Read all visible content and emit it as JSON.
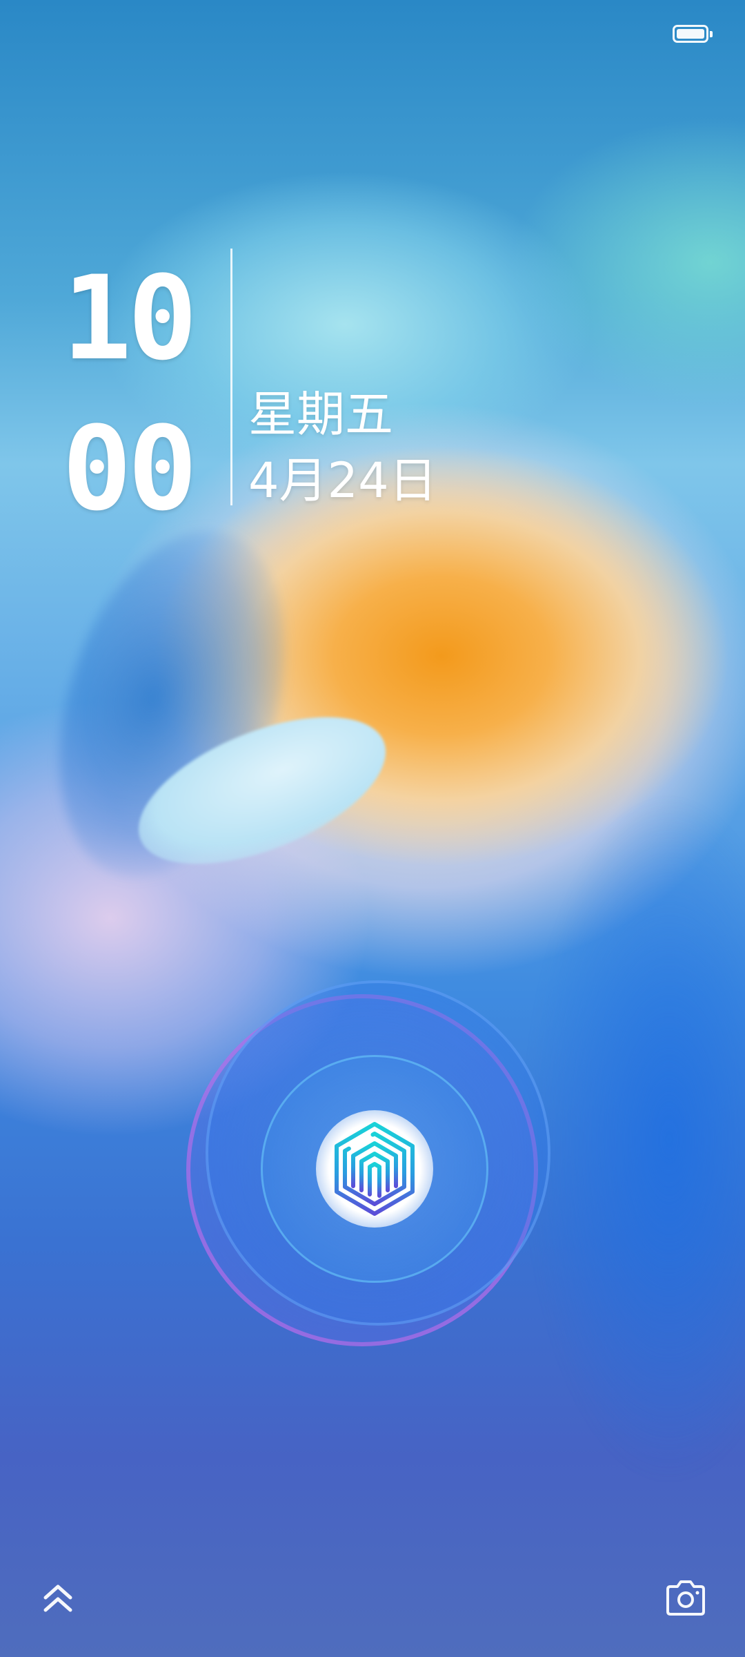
{
  "status_bar": {
    "battery_icon": "battery-full-icon",
    "battery_level": 1.0
  },
  "lock_screen": {
    "clock": {
      "hour": "10",
      "minute": "00"
    },
    "weekday": "星期五",
    "date": "4月24日",
    "fingerprint_icon": "fingerprint-icon"
  },
  "bottom_bar": {
    "left_icon": "chevron-up-icon",
    "right_icon": "camera-icon"
  },
  "colors": {
    "text": "#ffffff",
    "fingerprint_teal": "#19c7d6",
    "fingerprint_violet": "#5b4ed8",
    "ring_magenta": "#cd6eeb"
  }
}
